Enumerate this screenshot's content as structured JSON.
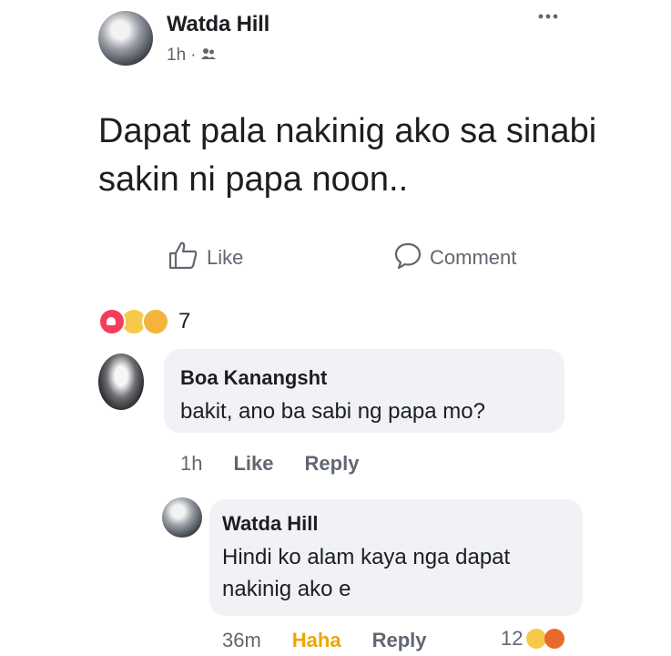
{
  "post": {
    "author": "Watda Hill",
    "time": "1h",
    "separator": "·",
    "text": "Dapat pala nakinig ako sa sinabi sakin ni papa noon..",
    "actions": {
      "like": "Like",
      "comment": "Comment"
    },
    "reaction_count": "7"
  },
  "comments": [
    {
      "author": "Boa Kanangsht",
      "text": "bakit, ano ba sabi ng papa mo?",
      "time": "1h",
      "like": "Like",
      "reply": "Reply"
    }
  ],
  "reply": {
    "author": "Watda Hill",
    "text": "Hindi ko alam kaya nga dapat nakinig ako e",
    "time": "36m",
    "reaction": "Haha",
    "reply": "Reply",
    "reaction_count": "12"
  },
  "colors": {
    "text": "#1c1e21",
    "secondary": "#606770",
    "bubble": "#f0f2f5",
    "haha": "#f0a500"
  },
  "icons": [
    "friends-icon",
    "more-options-icon",
    "like-icon",
    "comment-icon",
    "love-reaction-icon",
    "sad-reaction-icon",
    "care-reaction-icon",
    "haha-reaction-icon",
    "angry-reaction-icon"
  ]
}
